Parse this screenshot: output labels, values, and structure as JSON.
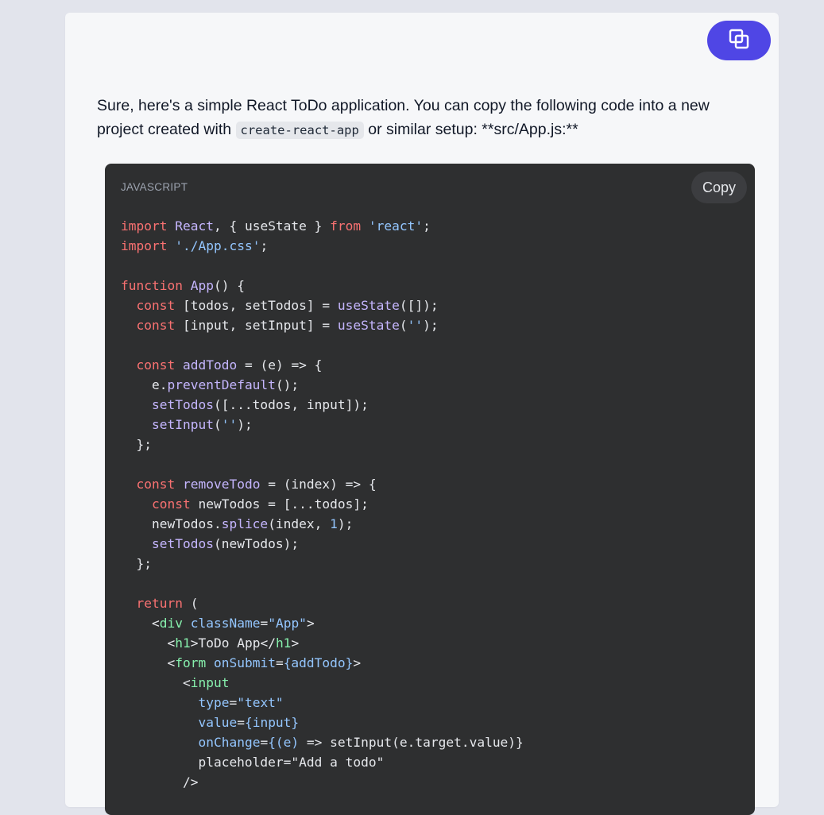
{
  "message": {
    "text_before": "Sure, here's a simple React ToDo application. You can copy the following code into a new project created with ",
    "inline_code": "create-react-app",
    "text_after": " or similar setup: **src/App.js:**"
  },
  "code_block": {
    "language": "JAVASCRIPT",
    "copy_label": "Copy",
    "lines": [
      [
        {
          "t": "import",
          "c": "kw"
        },
        {
          "t": " ",
          "c": "tx"
        },
        {
          "t": "React",
          "c": "fn"
        },
        {
          "t": ", { useState } ",
          "c": "tx"
        },
        {
          "t": "from",
          "c": "kw"
        },
        {
          "t": " ",
          "c": "tx"
        },
        {
          "t": "'react'",
          "c": "str"
        },
        {
          "t": ";",
          "c": "tx"
        }
      ],
      [
        {
          "t": "import",
          "c": "kw"
        },
        {
          "t": " ",
          "c": "tx"
        },
        {
          "t": "'./App.css'",
          "c": "str"
        },
        {
          "t": ";",
          "c": "tx"
        }
      ],
      [],
      [
        {
          "t": "function",
          "c": "kw"
        },
        {
          "t": " ",
          "c": "tx"
        },
        {
          "t": "App",
          "c": "fn"
        },
        {
          "t": "() {",
          "c": "tx"
        }
      ],
      [
        {
          "t": "  ",
          "c": "tx"
        },
        {
          "t": "const",
          "c": "kw"
        },
        {
          "t": " [todos, setTodos] = ",
          "c": "tx"
        },
        {
          "t": "useState",
          "c": "fn"
        },
        {
          "t": "([]);",
          "c": "tx"
        }
      ],
      [
        {
          "t": "  ",
          "c": "tx"
        },
        {
          "t": "const",
          "c": "kw"
        },
        {
          "t": " [input, setInput] = ",
          "c": "tx"
        },
        {
          "t": "useState",
          "c": "fn"
        },
        {
          "t": "(",
          "c": "tx"
        },
        {
          "t": "''",
          "c": "str"
        },
        {
          "t": ");",
          "c": "tx"
        }
      ],
      [],
      [
        {
          "t": "  ",
          "c": "tx"
        },
        {
          "t": "const",
          "c": "kw"
        },
        {
          "t": " ",
          "c": "tx"
        },
        {
          "t": "addTodo",
          "c": "fn"
        },
        {
          "t": " = (e) => {",
          "c": "tx"
        }
      ],
      [
        {
          "t": "    e.",
          "c": "tx"
        },
        {
          "t": "preventDefault",
          "c": "fn"
        },
        {
          "t": "();",
          "c": "tx"
        }
      ],
      [
        {
          "t": "    ",
          "c": "tx"
        },
        {
          "t": "setTodos",
          "c": "fn"
        },
        {
          "t": "([...todos, input]);",
          "c": "tx"
        }
      ],
      [
        {
          "t": "    ",
          "c": "tx"
        },
        {
          "t": "setInput",
          "c": "fn"
        },
        {
          "t": "(",
          "c": "tx"
        },
        {
          "t": "''",
          "c": "str"
        },
        {
          "t": ");",
          "c": "tx"
        }
      ],
      [
        {
          "t": "  };",
          "c": "tx"
        }
      ],
      [],
      [
        {
          "t": "  ",
          "c": "tx"
        },
        {
          "t": "const",
          "c": "kw"
        },
        {
          "t": " ",
          "c": "tx"
        },
        {
          "t": "removeTodo",
          "c": "fn"
        },
        {
          "t": " = (index) => {",
          "c": "tx"
        }
      ],
      [
        {
          "t": "    ",
          "c": "tx"
        },
        {
          "t": "const",
          "c": "kw"
        },
        {
          "t": " newTodos = [...todos];",
          "c": "tx"
        }
      ],
      [
        {
          "t": "    newTodos.",
          "c": "tx"
        },
        {
          "t": "splice",
          "c": "fn"
        },
        {
          "t": "(index, ",
          "c": "tx"
        },
        {
          "t": "1",
          "c": "num"
        },
        {
          "t": ");",
          "c": "tx"
        }
      ],
      [
        {
          "t": "    ",
          "c": "tx"
        },
        {
          "t": "setTodos",
          "c": "fn"
        },
        {
          "t": "(newTodos);",
          "c": "tx"
        }
      ],
      [
        {
          "t": "  };",
          "c": "tx"
        }
      ],
      [],
      [
        {
          "t": "  ",
          "c": "tx"
        },
        {
          "t": "return",
          "c": "kw"
        },
        {
          "t": " (",
          "c": "tx"
        }
      ],
      [
        {
          "t": "    <",
          "c": "tx"
        },
        {
          "t": "div",
          "c": "tag"
        },
        {
          "t": " ",
          "c": "tx"
        },
        {
          "t": "className",
          "c": "attr"
        },
        {
          "t": "=",
          "c": "tx"
        },
        {
          "t": "\"App\"",
          "c": "str"
        },
        {
          "t": ">",
          "c": "tx"
        }
      ],
      [
        {
          "t": "      <",
          "c": "tx"
        },
        {
          "t": "h1",
          "c": "tag"
        },
        {
          "t": ">ToDo App</",
          "c": "tx"
        },
        {
          "t": "h1",
          "c": "tag"
        },
        {
          "t": ">",
          "c": "tx"
        }
      ],
      [
        {
          "t": "      <",
          "c": "tx"
        },
        {
          "t": "form",
          "c": "tag"
        },
        {
          "t": " ",
          "c": "tx"
        },
        {
          "t": "onSubmit",
          "c": "attr"
        },
        {
          "t": "=",
          "c": "tx"
        },
        {
          "t": "{addTodo}",
          "c": "str"
        },
        {
          "t": ">",
          "c": "tx"
        }
      ],
      [
        {
          "t": "        <",
          "c": "tx"
        },
        {
          "t": "input",
          "c": "tag"
        }
      ],
      [
        {
          "t": "          ",
          "c": "tx"
        },
        {
          "t": "type",
          "c": "attr"
        },
        {
          "t": "=",
          "c": "tx"
        },
        {
          "t": "\"text\"",
          "c": "str"
        }
      ],
      [
        {
          "t": "          ",
          "c": "tx"
        },
        {
          "t": "value",
          "c": "attr"
        },
        {
          "t": "=",
          "c": "tx"
        },
        {
          "t": "{input}",
          "c": "str"
        }
      ],
      [
        {
          "t": "          ",
          "c": "tx"
        },
        {
          "t": "onChange",
          "c": "attr"
        },
        {
          "t": "=",
          "c": "tx"
        },
        {
          "t": "{(e)",
          "c": "str"
        },
        {
          "t": " => setInput(e.target.value)}",
          "c": "tx"
        }
      ],
      [
        {
          "t": "          placeholder=\"Add a todo\"",
          "c": "tx"
        }
      ],
      [
        {
          "t": "        />",
          "c": "tx"
        }
      ]
    ]
  },
  "colors": {
    "accent": "#4f46e5",
    "code_bg": "#2e2f30",
    "page_bg": "#e2e4ec",
    "card_bg": "#f6f7f9"
  },
  "icons": {
    "top_button": "copy-windows-icon"
  }
}
